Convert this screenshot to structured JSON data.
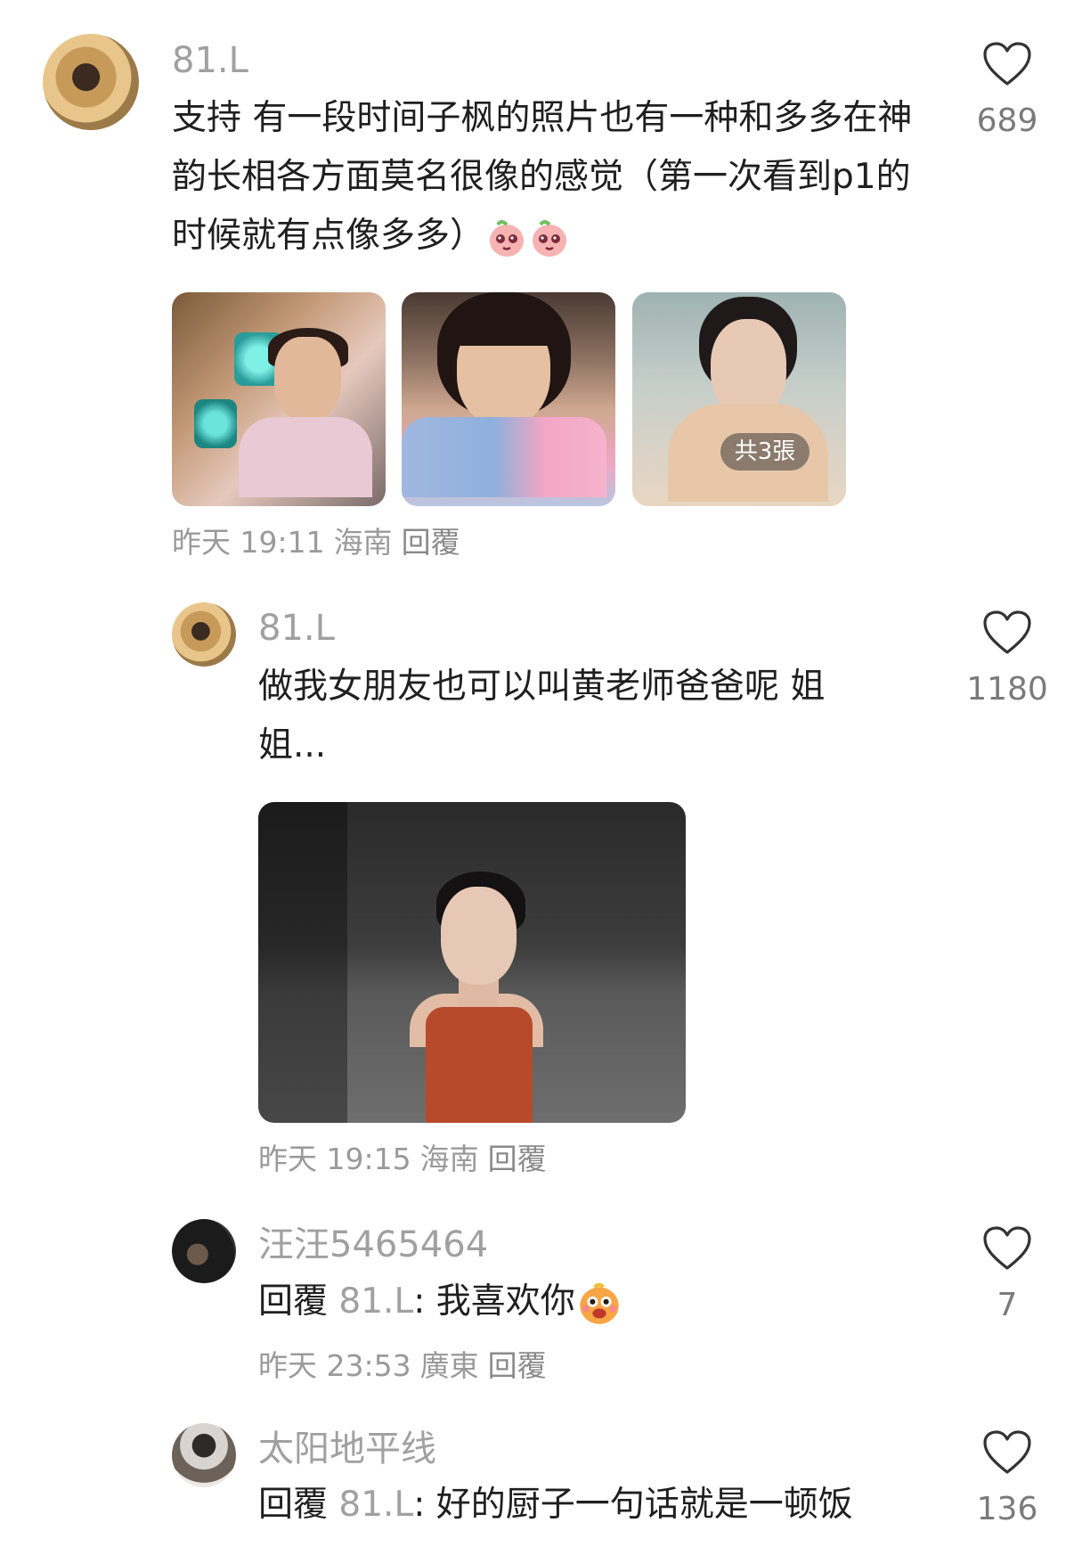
{
  "comments": [
    {
      "username": "81.L",
      "text": "支持 有一段时间子枫的照片也有一种和多多在神韵长相各方面莫名很像的感觉（第一次看到p1的时候就有点像多多）",
      "emojis": [
        "blush-face-emoji",
        "blush-face-emoji"
      ],
      "photos_badge": "共3張",
      "time": "昨天 19:11",
      "location": "海南",
      "reply_label": "回覆",
      "likes": "689"
    },
    {
      "username": "81.L",
      "text": "做我女朋友也可以叫黄老师爸爸呢 姐姐...",
      "time": "昨天 19:15",
      "location": "海南",
      "reply_label": "回覆",
      "likes": "1180"
    },
    {
      "username": "汪汪5465464",
      "reply_prefix": "回覆",
      "reply_to": "81.L",
      "text": ": 我喜欢你",
      "emoji": "grinning-face-emoji",
      "time": "昨天 23:53",
      "location": "廣東",
      "reply_label": "回覆",
      "likes": "7"
    },
    {
      "username": "太阳地平线",
      "reply_prefix": "回覆",
      "reply_to": "81.L",
      "text": ": 好的厨子一句话就是一顿饭",
      "likes": "136"
    }
  ],
  "icons": {
    "like": "heart-outline-icon"
  },
  "colors": {
    "meta": "#9a9a9a",
    "username": "#a0a0a0",
    "text": "#1f1f1f"
  }
}
